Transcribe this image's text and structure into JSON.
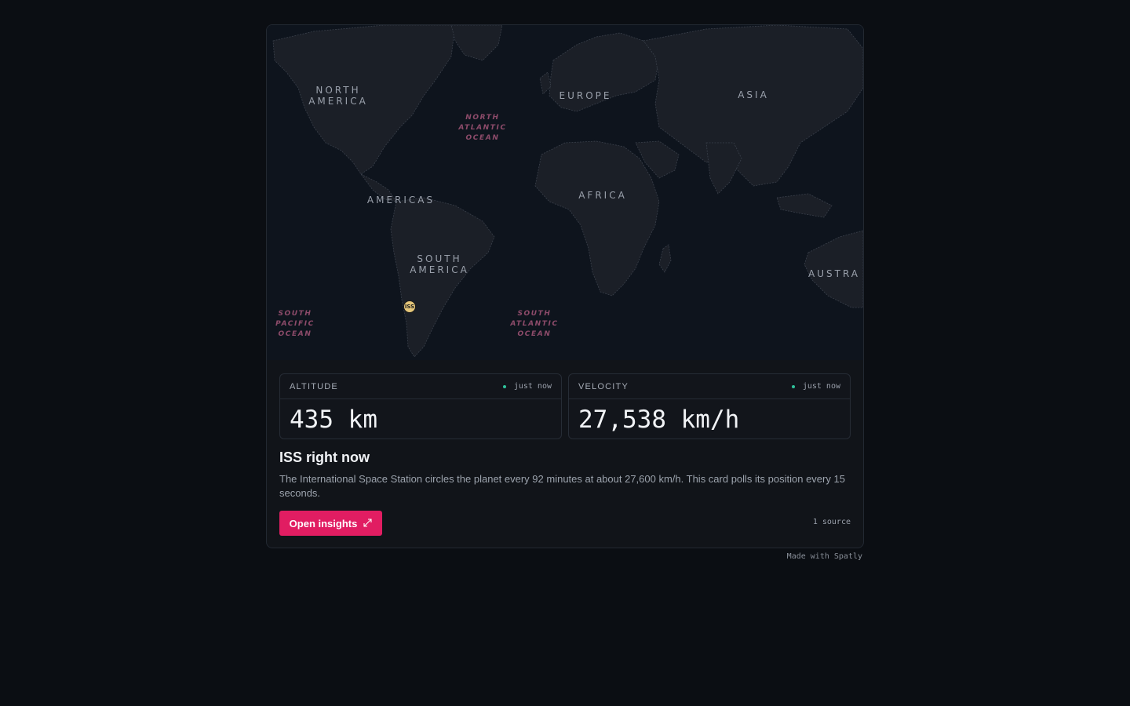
{
  "map": {
    "regions": {
      "north_america": "NORTH\nAMERICA",
      "europe": "EUROPE",
      "asia": "ASIA",
      "americas": "AMERICAS",
      "africa": "AFRICA",
      "south_america": "SOUTH\nAMERICA",
      "australia": "AUSTRA"
    },
    "oceans": {
      "north_atlantic": "NORTH\nATLANTIC\nOCEAN",
      "south_pacific": "SOUTH\nPACIFIC\nOCEAN",
      "south_atlantic": "SOUTH\nATLANTIC\nOCEAN"
    },
    "marker_label": "ISS",
    "colors": {
      "land": "#1b1f27",
      "ocean": "#0e141d",
      "border": "#3a404b",
      "ocean_label": "#8d4b6a"
    }
  },
  "stats": {
    "altitude": {
      "label": "ALTITUDE",
      "status": "just now",
      "value": "435 km"
    },
    "velocity": {
      "label": "VELOCITY",
      "status": "just now",
      "value": "27,538 km/h"
    }
  },
  "info": {
    "title": "ISS right now",
    "description": "The International Space Station circles the planet every 92 minutes at about 27,600 km/h. This card polls its position every 15 seconds."
  },
  "actions": {
    "open_label": "Open insights",
    "open_icon": "external-link-icon",
    "sources": "1 source"
  },
  "footer": {
    "made_with": "Made with Spatly"
  },
  "colors": {
    "accent": "#e11d62",
    "status_dot": "#2fc29b",
    "background": "#0b0e13"
  }
}
